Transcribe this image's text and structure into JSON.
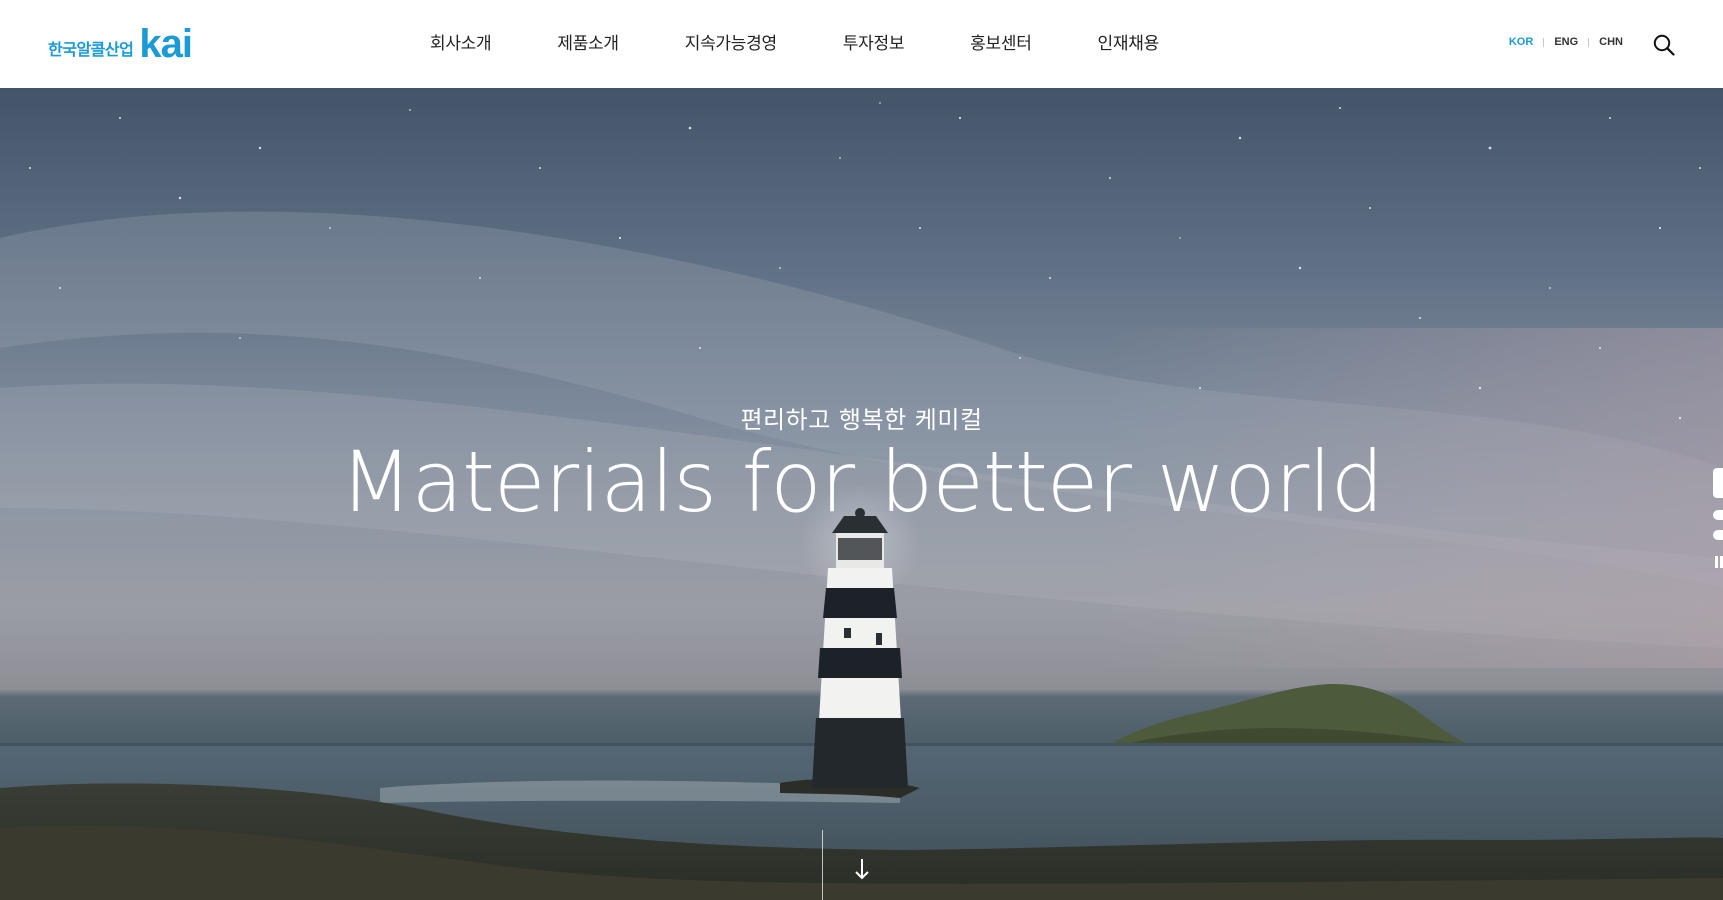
{
  "header": {
    "logo_ko": "한국알콜산업",
    "logo_en": "kai",
    "nav": [
      "회사소개",
      "제품소개",
      "지속가능경영",
      "투자정보",
      "홍보센터",
      "인재채용"
    ],
    "languages": [
      "KOR",
      "ENG",
      "CHN"
    ],
    "active_language": "KOR",
    "search_icon": "search-icon"
  },
  "hero": {
    "subtitle": "편리하고 행복한 케미컬",
    "title": "Materials for better world",
    "scroll_icon": "arrow-down-icon",
    "slides_total": 3,
    "slide_active": 1,
    "pause_icon": "pause-icon"
  },
  "colors": {
    "brand": "#1c9ad6",
    "nav_text": "#222222",
    "hero_text": "#ffffff"
  }
}
